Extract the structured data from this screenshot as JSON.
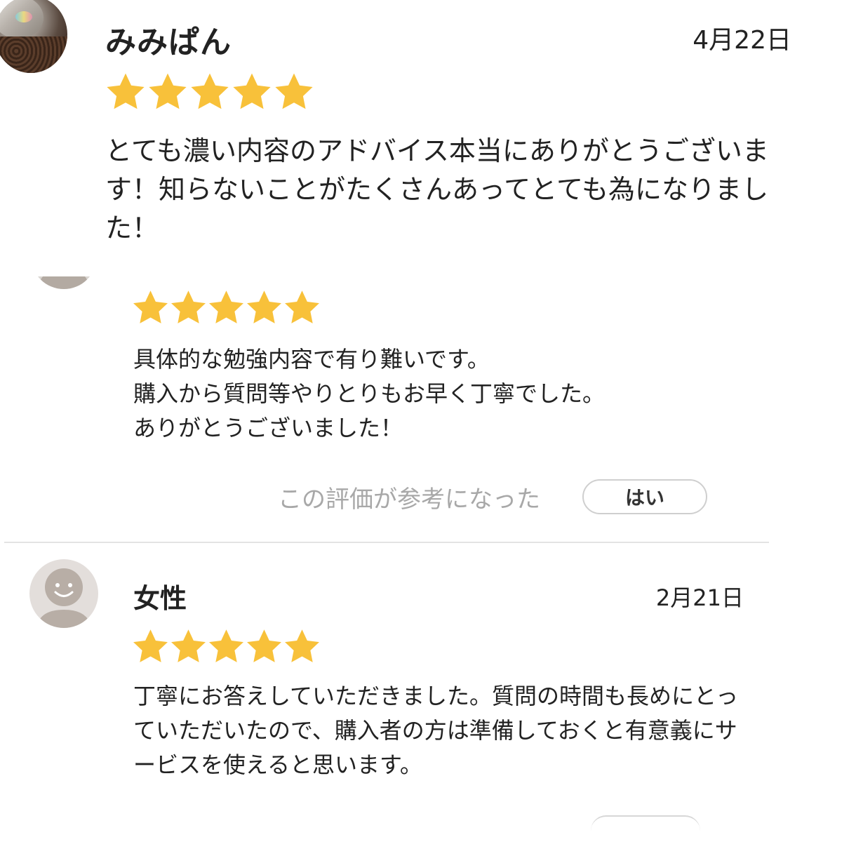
{
  "reviews": [
    {
      "reviewer": "みみぱん",
      "date": "4月22日",
      "rating": 5,
      "body": "とても濃い内容のアドバイス本当にありがとうございます！知らないことがたくさんあってとても為になりました！",
      "avatar": "user-photo-avatar"
    },
    {
      "rating": 5,
      "body": "具体的な勉強内容で有り難いです。\n購入から質問等やりとりもお早く丁寧でした。\nありがとうございました！",
      "avatar": "default-avatar-icon",
      "helpful": {
        "label": "この評価が参考になった",
        "button": "はい"
      }
    },
    {
      "reviewer": "女性",
      "date": "2月21日",
      "rating": 5,
      "body": "丁寧にお答えしていただきました。質問の時間も長めにとっていただいたので、購入者の方は準備しておくと有意義にサービスを使えると思います。",
      "avatar": "default-avatar-icon"
    }
  ],
  "colors": {
    "star": "#F8C13A",
    "divider": "#E3E3E3",
    "helpful_label": "#A8A8A8"
  }
}
